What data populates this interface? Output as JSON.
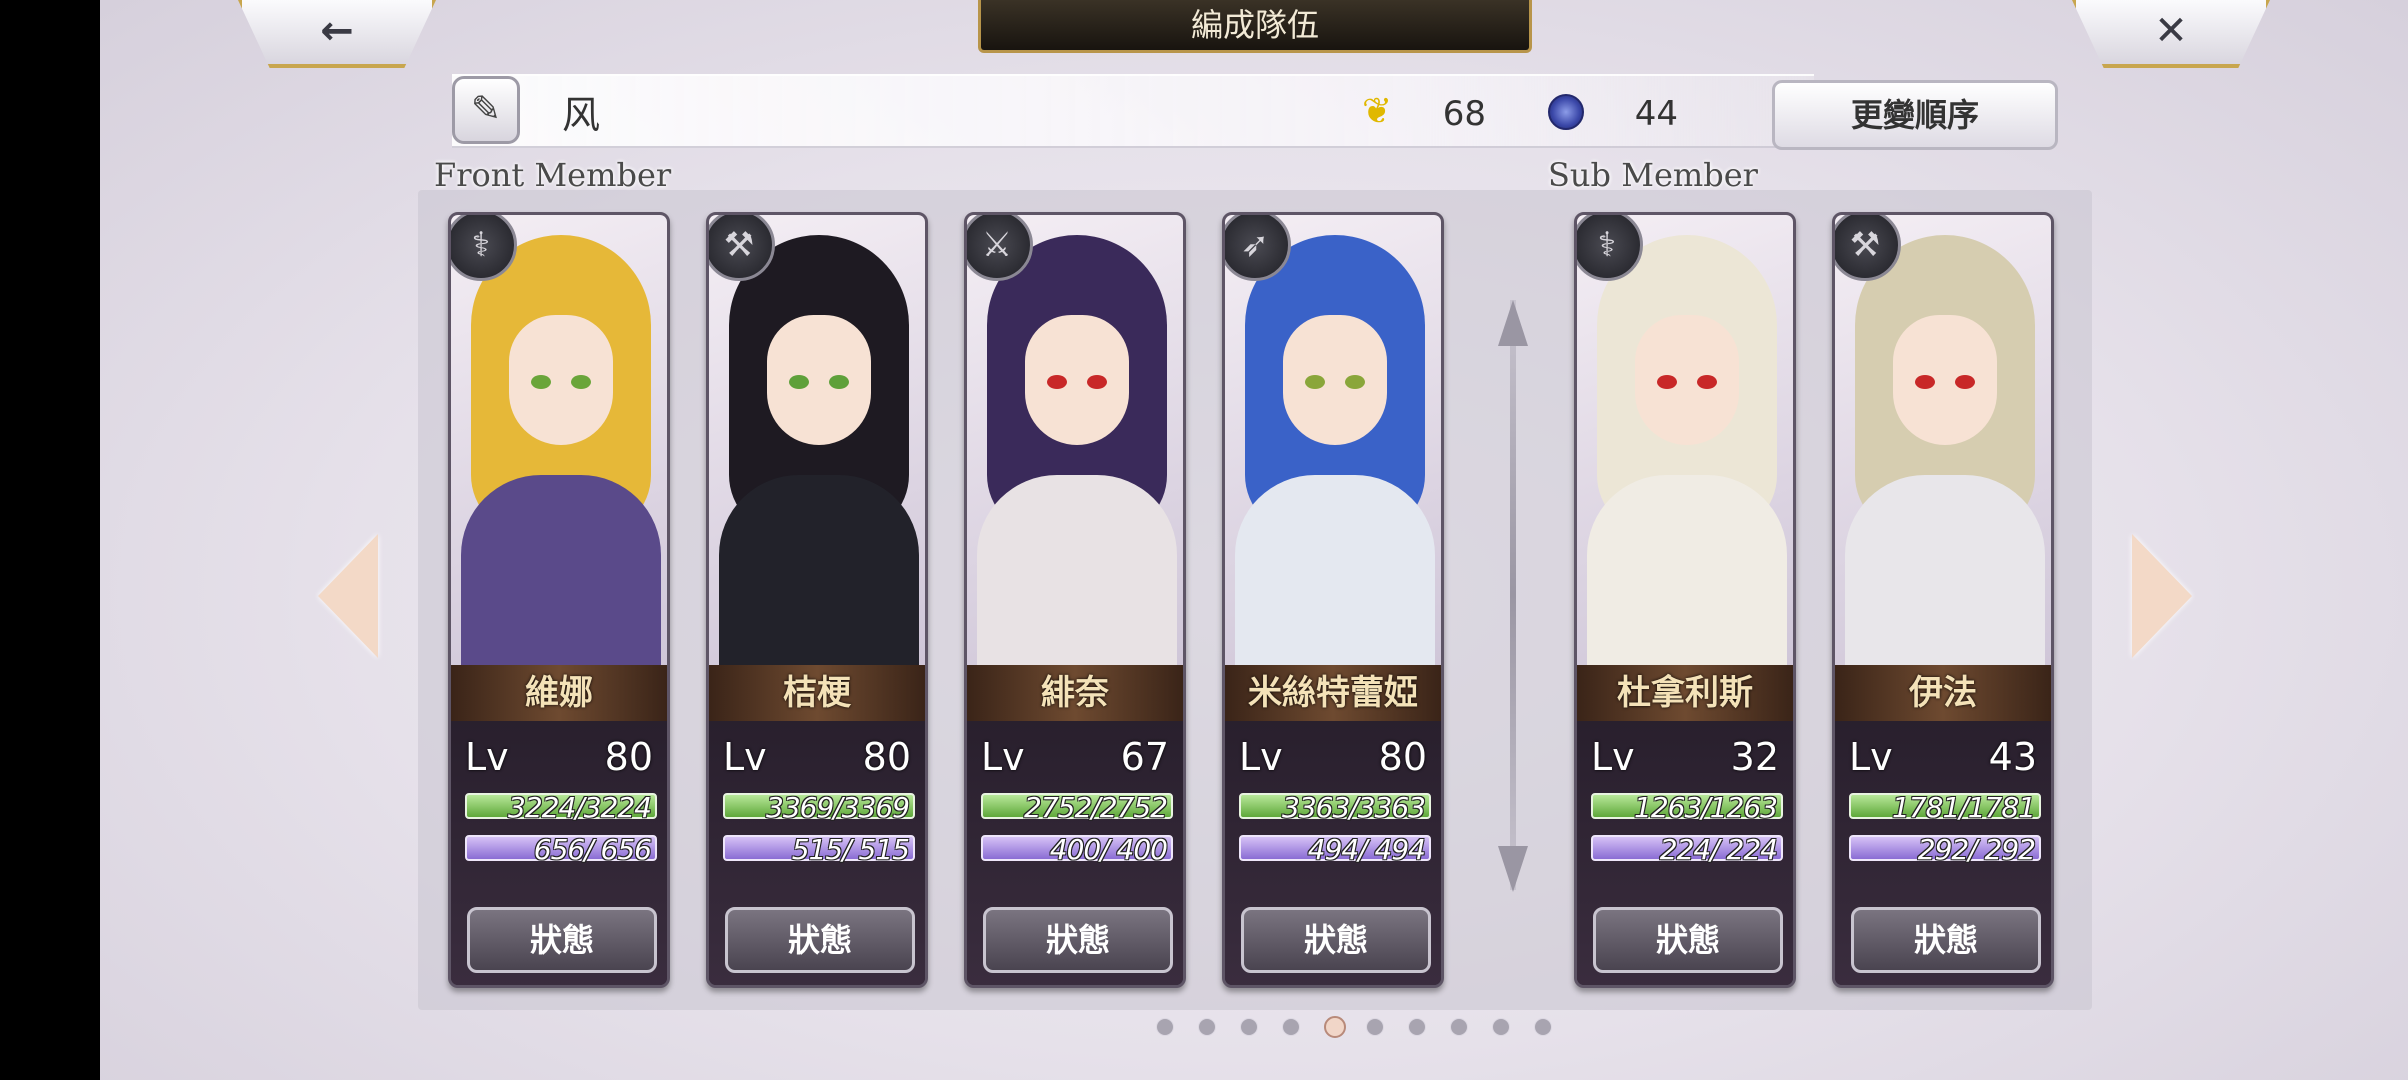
{
  "header": {
    "title": "編成隊伍",
    "back_icon": "←",
    "close_icon": "✕"
  },
  "party": {
    "edit_icon": "✎",
    "name": "风",
    "feather_icon": "❦",
    "feather_count": "68",
    "orb_count": "44",
    "reorder_label": "更變順序"
  },
  "sections": {
    "front": "Front Member",
    "sub": "Sub Member"
  },
  "status_label": "狀態",
  "front_members": [
    {
      "name": "維娜",
      "lv": "80",
      "hp": "3224/3224",
      "mp": "656/ 656",
      "class_icon": "staff-icon",
      "class_glyph": "⚕",
      "hair": "#e6b838",
      "eye": "#6aa53a",
      "body": "#5a4a8a"
    },
    {
      "name": "桔梗",
      "lv": "80",
      "hp": "3369/3369",
      "mp": "515/ 515",
      "class_icon": "axe-icon",
      "class_glyph": "⚒",
      "hair": "#1e1a22",
      "eye": "#5fa03a",
      "body": "#22222a"
    },
    {
      "name": "緋奈",
      "lv": "67",
      "hp": "2752/2752",
      "mp": "400/ 400",
      "class_icon": "sword-icon",
      "class_glyph": "⚔",
      "hair": "#3a2a5a",
      "eye": "#c82828",
      "body": "#e8e2e4"
    },
    {
      "name": "米絲特蕾婭",
      "lv": "80",
      "hp": "3363/3363",
      "mp": "494/ 494",
      "class_icon": "bow-icon",
      "class_glyph": "➶",
      "hair": "#3a62c8",
      "eye": "#8aa63a",
      "body": "#e4e8f0"
    }
  ],
  "sub_members": [
    {
      "name": "杜拿利斯",
      "lv": "32",
      "hp": "1263/1263",
      "mp": "224/ 224",
      "class_icon": "staff-icon",
      "class_glyph": "⚕",
      "hair": "#ece6d6",
      "eye": "#c82828",
      "body": "#f0ece4"
    },
    {
      "name": "伊法",
      "lv": "43",
      "hp": "1781/1781",
      "mp": "292/ 292",
      "class_icon": "hammer-icon",
      "class_glyph": "⚒",
      "hair": "#d6cdb0",
      "eye": "#c82828",
      "body": "#e8e6ea"
    }
  ],
  "pagination": {
    "total": 10,
    "active": 5
  },
  "colors": {
    "accent_gold": "#c8a64e",
    "hp_green": "#5fa83a",
    "mp_purple": "#8a6cd4"
  }
}
